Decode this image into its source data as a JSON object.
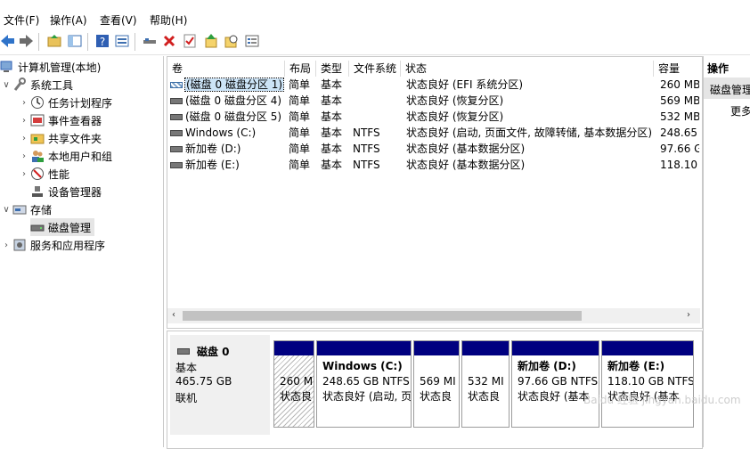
{
  "menu": {
    "file": "文件(F)",
    "action": "操作(A)",
    "view": "查看(V)",
    "help": "帮助(H)"
  },
  "toolbar": {
    "icons": [
      "back-icon",
      "forward-icon",
      "up-folder-icon",
      "show-tree-icon",
      "help-icon",
      "properties-icon",
      "connect-icon",
      "delete-icon",
      "check-icon",
      "import-icon",
      "search-icon",
      "settings-icon"
    ]
  },
  "tree": {
    "root": "计算机管理(本地)",
    "system_tools": "系统工具",
    "task_scheduler": "任务计划程序",
    "event_viewer": "事件查看器",
    "shared_folders": "共享文件夹",
    "local_users": "本地用户和组",
    "performance": "性能",
    "device_manager": "设备管理器",
    "storage": "存储",
    "disk_management": "磁盘管理",
    "services": "服务和应用程序"
  },
  "volumes": {
    "columns": [
      "卷",
      "布局",
      "类型",
      "文件系统",
      "状态",
      "容量"
    ],
    "rows": [
      {
        "name": "(磁盘 0 磁盘分区 1)",
        "layout": "简单",
        "type": "基本",
        "fs": "",
        "status": "状态良好 (EFI 系统分区)",
        "capacity": "260 MB"
      },
      {
        "name": "(磁盘 0 磁盘分区 4)",
        "layout": "简单",
        "type": "基本",
        "fs": "",
        "status": "状态良好 (恢复分区)",
        "capacity": "569 MB"
      },
      {
        "name": "(磁盘 0 磁盘分区 5)",
        "layout": "简单",
        "type": "基本",
        "fs": "",
        "status": "状态良好 (恢复分区)",
        "capacity": "532 MB"
      },
      {
        "name": "Windows (C:)",
        "layout": "简单",
        "type": "基本",
        "fs": "NTFS",
        "status": "状态良好 (启动, 页面文件, 故障转储, 基本数据分区)",
        "capacity": "248.65"
      },
      {
        "name": "新加卷 (D:)",
        "layout": "简单",
        "type": "基本",
        "fs": "NTFS",
        "status": "状态良好 (基本数据分区)",
        "capacity": "97.66 G"
      },
      {
        "name": "新加卷 (E:)",
        "layout": "简单",
        "type": "基本",
        "fs": "NTFS",
        "status": "状态良好 (基本数据分区)",
        "capacity": "118.10"
      }
    ]
  },
  "disk": {
    "name": "磁盘 0",
    "type": "基本",
    "size": "465.75 GB",
    "status": "联机",
    "partitions": [
      {
        "title": "",
        "line1": "260 M",
        "line2": "状态良"
      },
      {
        "title": "Windows  (C:)",
        "line1": "248.65 GB NTFS",
        "line2": "状态良好 (启动, 页"
      },
      {
        "title": "",
        "line1": "569 MI",
        "line2": "状态良"
      },
      {
        "title": "",
        "line1": "532 MI",
        "line2": "状态良"
      },
      {
        "title": "新加卷  (D:)",
        "line1": "97.66 GB NTFS",
        "line2": "状态良好 (基本"
      },
      {
        "title": "新加卷  (E:)",
        "line1": "118.10 GB NTFS",
        "line2": "状态良好 (基本"
      }
    ]
  },
  "actions": {
    "header": "操作",
    "item": "磁盘管理",
    "more": "更多"
  },
  "watermark": "Baidu 经验 jingyan.baidu.com"
}
